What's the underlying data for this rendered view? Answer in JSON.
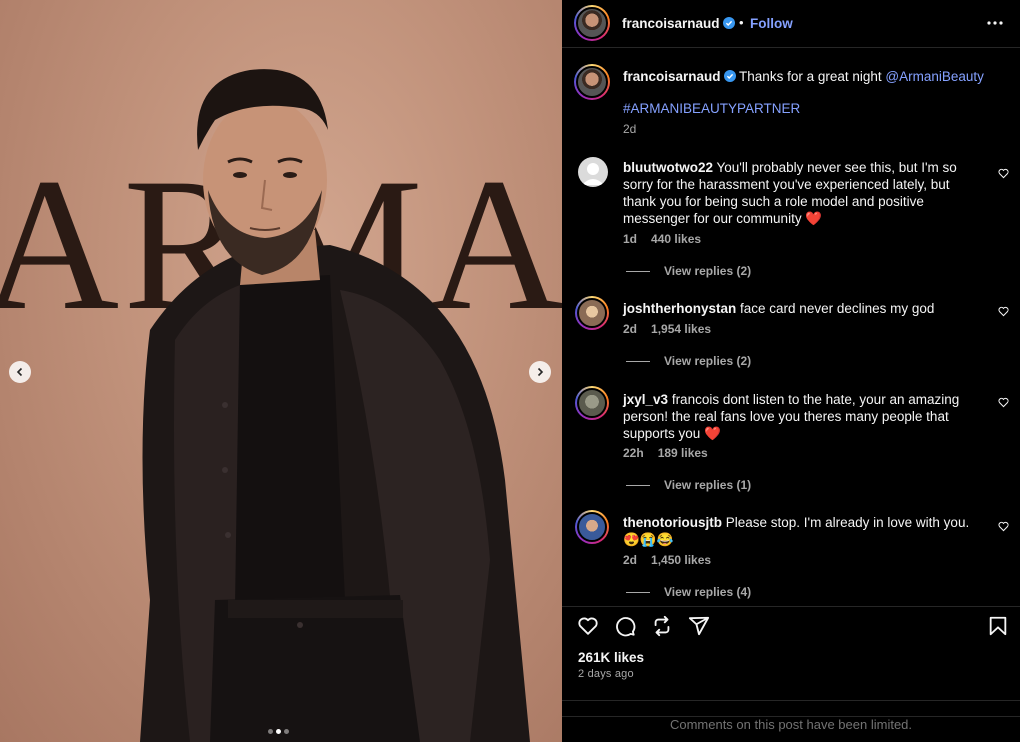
{
  "media": {
    "backdrop_text": "ARMANI",
    "dots": [
      false,
      true,
      false
    ]
  },
  "post": {
    "author": "francoisarnaud",
    "follow_label": "Follow",
    "separator": "•",
    "caption": {
      "prefix": "Thanks for a great night ",
      "mention": "@ArmaniBeauty",
      "hashtag": "#ARMANIBEAUTYPARTNER",
      "time": "2d"
    },
    "likes": "261K likes",
    "posted": "2 days ago",
    "limited_notice": "Comments on this post have been limited."
  },
  "comments": [
    {
      "user": "bluutwotwo22",
      "text": "You'll probably never see this, but I'm so sorry for the harassment you've experienced lately, but thank you for being such a role model and positive messenger for our community ❤️",
      "time": "1d",
      "likes": "440 likes",
      "replies": "View replies (2)"
    },
    {
      "user": "joshtherhonystan",
      "text": "face card never declines my god",
      "time": "2d",
      "likes": "1,954 likes",
      "replies": "View replies (2)"
    },
    {
      "user": "jxyl_v3",
      "text": "francois dont listen to the hate, your an amazing person! the real fans love you theres many people that supports you ❤️",
      "time": "22h",
      "likes": "189 likes",
      "replies": "View replies (1)"
    },
    {
      "user": "thenotoriousjtb",
      "text": "Please stop. I'm already in love with you. 😍😭😂",
      "time": "2d",
      "likes": "1,450 likes",
      "replies": "View replies (4)"
    }
  ],
  "colors": {
    "accent": "#85a1ff",
    "secondary_text": "#a8a8a8",
    "muted_text": "#737373",
    "panel_bg": "#000000"
  },
  "icons": [
    "verified-badge-icon",
    "more-options-icon",
    "heart-icon",
    "comment-icon",
    "repost-icon",
    "share-icon",
    "bookmark-icon",
    "chevron-left-icon",
    "chevron-right-icon"
  ]
}
